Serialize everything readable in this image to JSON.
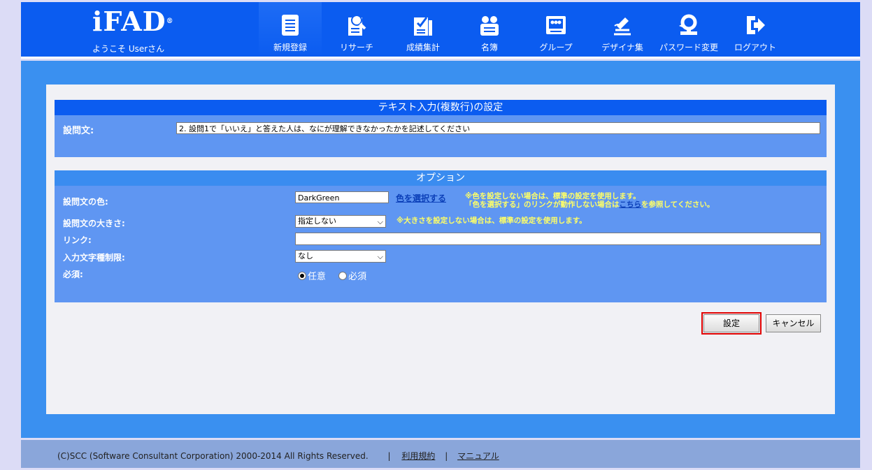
{
  "header": {
    "logo": "iFAD",
    "logo_mark": "®",
    "welcome": "ようこそ Userさん",
    "nav": [
      {
        "label": "新規登録",
        "icon": "document-icon",
        "active": true
      },
      {
        "label": "リサーチ",
        "icon": "research-icon",
        "active": false
      },
      {
        "label": "成績集計",
        "icon": "checklist-icon",
        "active": false
      },
      {
        "label": "名簿",
        "icon": "people-icon",
        "active": false
      },
      {
        "label": "グループ",
        "icon": "group-icon",
        "active": false
      },
      {
        "label": "デザイナ集",
        "icon": "designer-icon",
        "active": false
      },
      {
        "label": "パスワード変更",
        "icon": "key-icon",
        "active": false
      },
      {
        "label": "ログアウト",
        "icon": "logout-icon",
        "active": false
      }
    ]
  },
  "question_panel": {
    "title": "テキスト入力(複数行)の設定",
    "label": "設問文:",
    "value": "2. 設問1で「いいえ」と答えた人は、なにが理解できなかったかを記述してください"
  },
  "options_panel": {
    "title": "オプション",
    "color_label": "設問文の色:",
    "color_value": "DarkGreen",
    "color_link": "色を選択する",
    "color_note_1": "※色を設定しない場合は、標準の設定を使用します。",
    "color_note_2a": "「色を選択する」のリンクが動作しない場合は",
    "color_note_link": "こちら",
    "color_note_2b": "を参照してください。",
    "size_label": "設問文の大きさ:",
    "size_value": "指定しない",
    "size_note": "※大きさを設定しない場合は、標準の設定を使用します。",
    "link_label": "リンク:",
    "link_value": "",
    "type_label": "入力文字種制限:",
    "type_value": "なし",
    "required_label": "必須:",
    "required_options": [
      "任意",
      "必須"
    ],
    "required_selected": 0
  },
  "buttons": {
    "save": "設定",
    "cancel": "キャンセル"
  },
  "footer": {
    "copyright": "(C)SCC (Software Consultant Corporation) 2000-2014 All Rights Reserved.",
    "sep": "|",
    "terms": "利用規約",
    "manual": "マニュアル"
  },
  "colors": {
    "header_blue": "#0b5cf0",
    "band_blue": "#3a90f0",
    "panel_blue": "#5f96f2",
    "note_yellow": "#ffff66",
    "highlight_red": "#e00000"
  }
}
